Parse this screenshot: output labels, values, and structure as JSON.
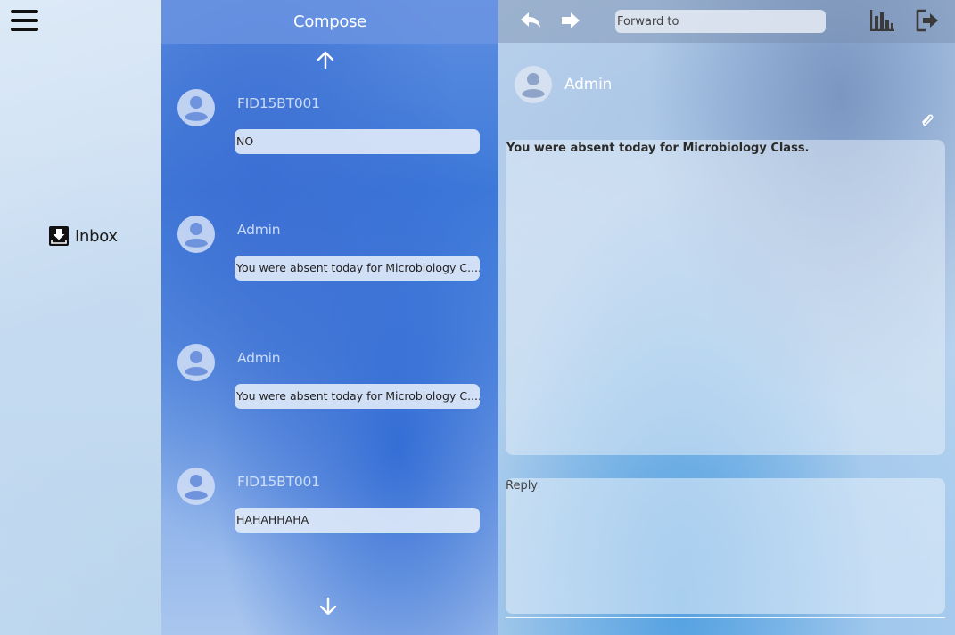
{
  "nav": {
    "menu_icon": "hamburger-menu-icon",
    "inbox_label": "Inbox",
    "inbox_icon": "inbox-download-icon"
  },
  "list": {
    "compose_label": "Compose",
    "scroll_up_icon": "arrow-up-icon",
    "scroll_down_icon": "arrow-down-icon",
    "messages": [
      {
        "sender": "FID15BT001",
        "preview": "NO"
      },
      {
        "sender": "Admin",
        "preview": "You were absent today for Microbiology C....."
      },
      {
        "sender": "Admin",
        "preview": "You were absent today for Microbiology C....."
      },
      {
        "sender": "FID15BT001",
        "preview": "HAHAHHAHA"
      }
    ]
  },
  "reader": {
    "reply_icon": "reply-arrow-icon",
    "forward_icon": "forward-arrow-icon",
    "forward_placeholder": "Forward to",
    "stats_icon": "bar-chart-icon",
    "logout_icon": "logout-icon",
    "sender": "Admin",
    "attachment_icon": "paperclip-icon",
    "body": "You were absent today for Microbiology Class.",
    "reply_placeholder": "Reply"
  },
  "colors": {
    "list_bg": "#4a82dc",
    "text_light": "#ffffff",
    "preview_bg": "#e1ebfa"
  }
}
